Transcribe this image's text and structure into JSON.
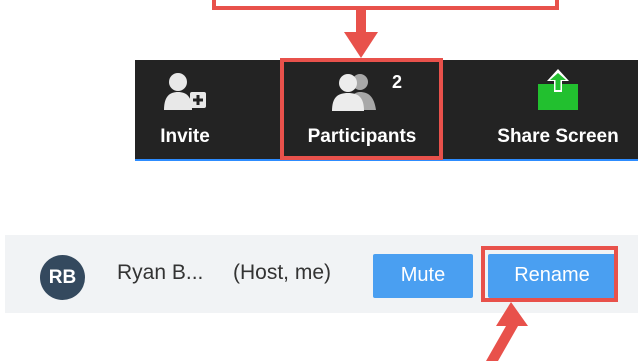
{
  "toolbar": {
    "invite": {
      "label": "Invite",
      "icon": "add-user-icon"
    },
    "participants": {
      "label": "Participants",
      "count": "2",
      "icon": "participants-icon"
    },
    "share": {
      "label": "Share Screen",
      "icon": "share-screen-icon"
    }
  },
  "participant": {
    "initials": "RB",
    "name": "Ryan B...",
    "role": "(Host, me)",
    "mute_label": "Mute",
    "rename_label": "Rename"
  },
  "colors": {
    "toolbar_bg": "#232323",
    "highlight_red": "#e8514b",
    "share_green": "#22c02f",
    "button_blue": "#4a9ff1",
    "avatar_bg": "#34495e"
  }
}
